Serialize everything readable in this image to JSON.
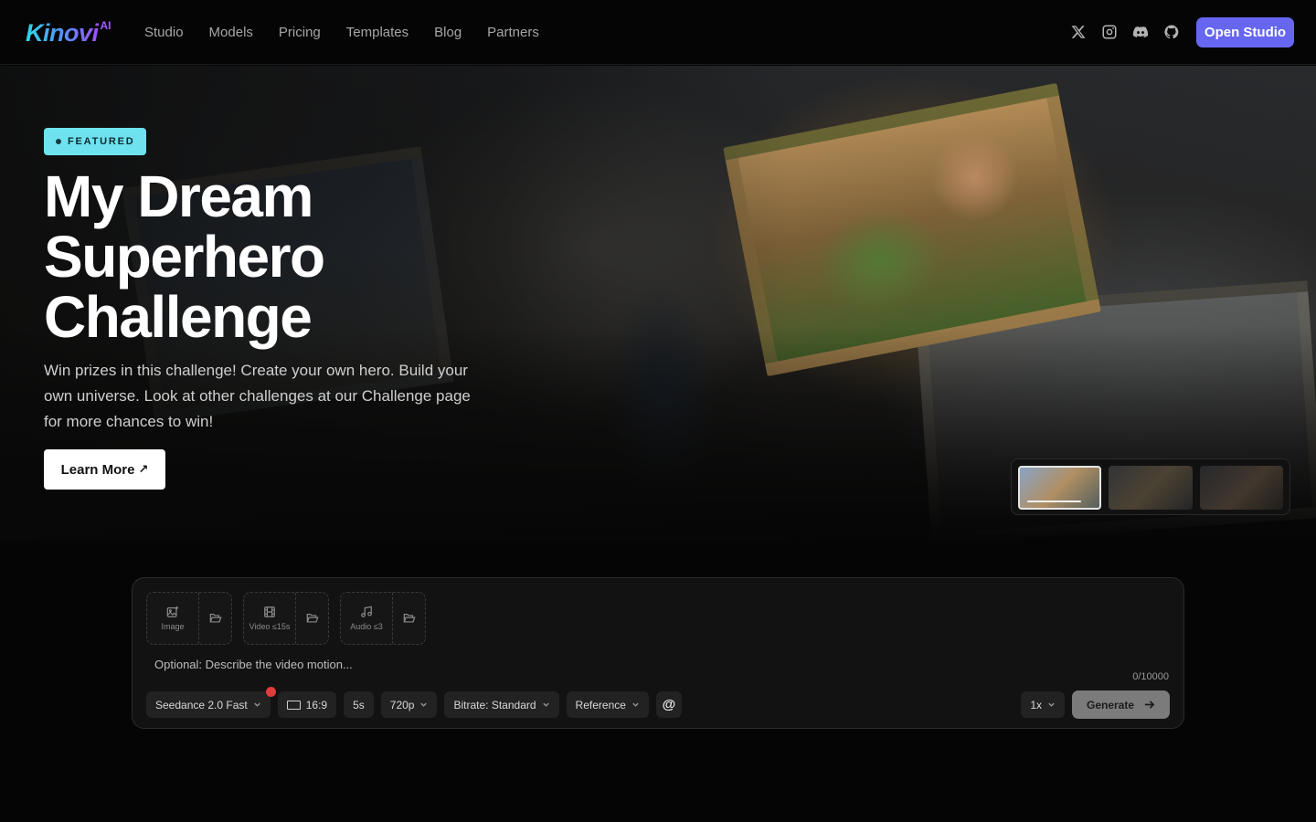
{
  "brand": {
    "name": "Kinovi",
    "suffix": "AI"
  },
  "nav": {
    "links": [
      "Studio",
      "Models",
      "Pricing",
      "Templates",
      "Blog",
      "Partners"
    ],
    "social_icons": [
      "x-icon",
      "instagram-icon",
      "discord-icon",
      "github-icon"
    ],
    "cta": "Open Studio"
  },
  "hero": {
    "badge": "FEATURED",
    "title_lines": [
      "My Dream",
      "Superhero",
      "Challenge"
    ],
    "description": "Win prizes in this challenge! Create your own hero. Build your own universe. Look at other challenges at our Challenge page for more chances to win!",
    "button": "Learn More",
    "button_arrow": "↗",
    "slides_selected": 1
  },
  "composer": {
    "uploads": [
      {
        "label": "Image",
        "icon": "image-add-icon"
      },
      {
        "label": "Video ≤15s",
        "icon": "film-icon"
      },
      {
        "label": "Audio ≤3",
        "icon": "music-note-icon"
      }
    ],
    "placeholder": "Optional: Describe the video motion...",
    "counter": "0/10000",
    "model": "Seedance 2.0 Fast",
    "aspect_ratio": "16:9",
    "duration": "5s",
    "resolution": "720p",
    "bitrate": "Bitrate: Standard",
    "mode": "Reference",
    "mention": "@",
    "count": "1x",
    "generate": "Generate"
  },
  "colors": {
    "accent": "#6666f0",
    "badge": "#6ee3ef",
    "background": "#050505",
    "notification": "#e23b3b"
  }
}
